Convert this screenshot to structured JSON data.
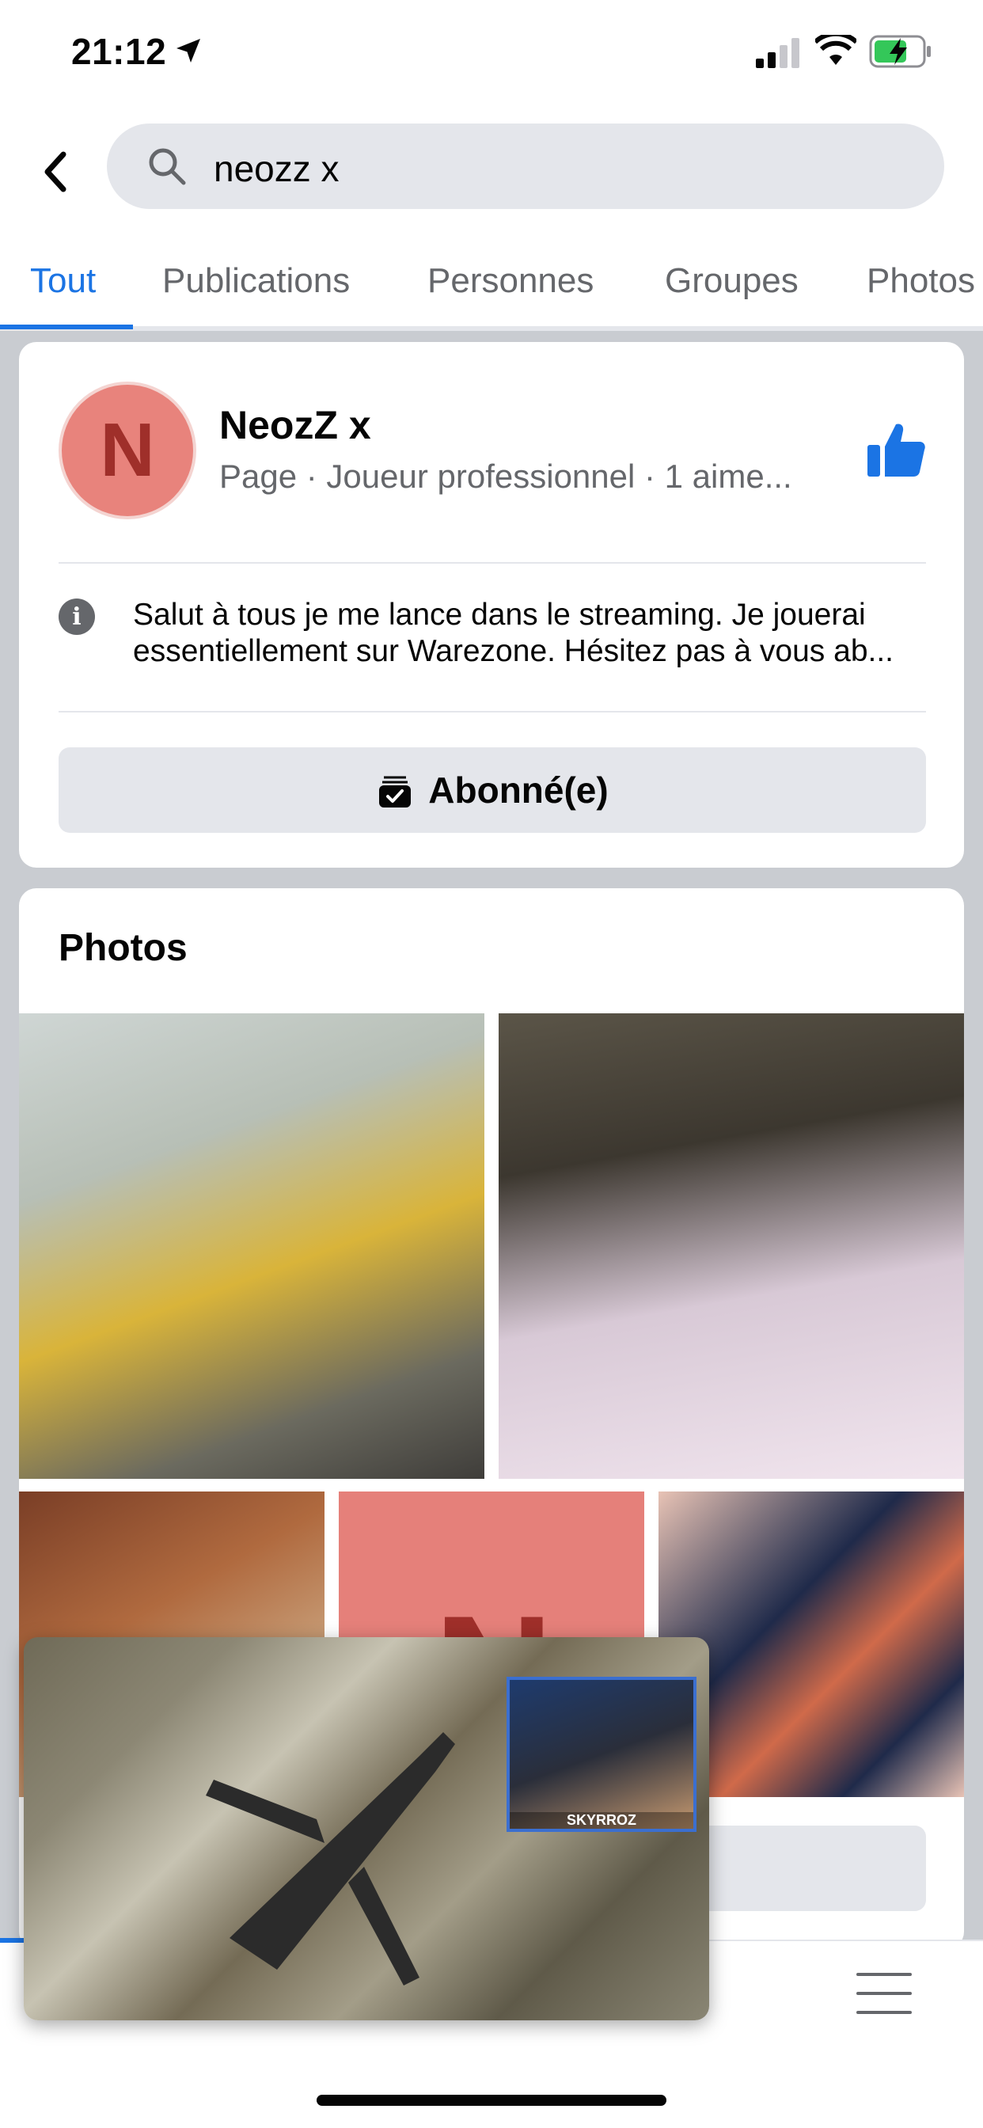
{
  "status_bar": {
    "time": "21:12"
  },
  "search": {
    "query": "neozz x"
  },
  "tabs": [
    {
      "label": "Tout",
      "active": true
    },
    {
      "label": "Publications"
    },
    {
      "label": "Personnes"
    },
    {
      "label": "Groupes"
    },
    {
      "label": "Photos"
    }
  ],
  "page_result": {
    "avatar_letter": "N",
    "name": "NeozZ x",
    "meta": "Page · Joueur professionnel · 1 aime...",
    "description_line1": "Salut à tous je me lance dans le streaming. Je jouerai",
    "description_line2": "essentiellement sur Warezone. Hésitez pas à vous ab...",
    "follow_label": "Abonné(e)"
  },
  "photos": {
    "title": "Photos",
    "tile_letter": "N"
  },
  "video_overlay": {
    "streamer_label": "SKYRROZ"
  },
  "colors": {
    "accent": "#1b74e4",
    "avatar": "#e8837c"
  }
}
